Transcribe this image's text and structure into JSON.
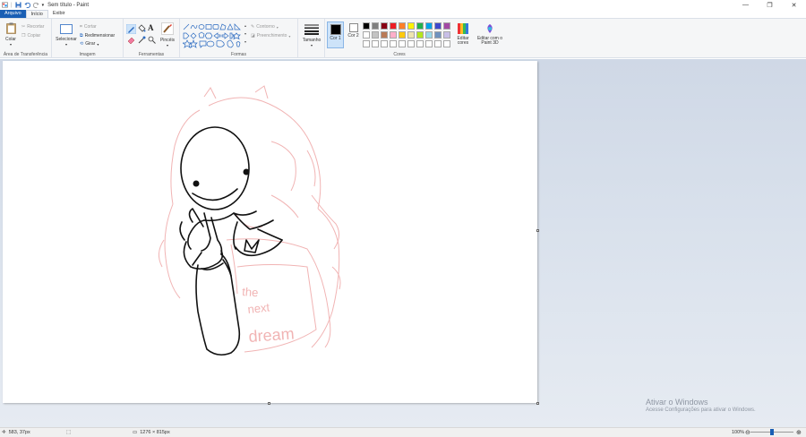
{
  "window": {
    "title": "Sem título - Paint",
    "controls": {
      "minimize": "—",
      "restore": "❐",
      "close": "✕"
    }
  },
  "tabs": [
    {
      "label": "Arquivo"
    },
    {
      "label": "Início"
    },
    {
      "label": "Exibir"
    }
  ],
  "ribbon": {
    "clipboard": {
      "paste": "Colar",
      "cut": "Recortar",
      "copy": "Copiar",
      "label": "Área de Transferência"
    },
    "image": {
      "select": "Selecionar",
      "crop": "Cortar",
      "resize": "Redimensionar",
      "rotate": "Girar",
      "label": "Imagem"
    },
    "tools": {
      "brush": "Pincéis",
      "label": "Ferramentas",
      "text_glyph": "A"
    },
    "shapes": {
      "outline": "Contorno",
      "fill": "Preenchimento",
      "label": "Formas"
    },
    "size": {
      "label": "Tamanho"
    },
    "colors": {
      "color1": "Cor 1",
      "color2": "Cor 2",
      "edit_colors": "Editar cores",
      "paint3d": "Editar com o Paint 3D",
      "label": "Cores",
      "palette": [
        "#000000",
        "#7f7f7f",
        "#880015",
        "#ed1c24",
        "#ff7f27",
        "#fff200",
        "#22b14c",
        "#00a2e8",
        "#3f48cc",
        "#a349a4",
        "#ffffff",
        "#c3c3c3",
        "#b97a57",
        "#ffaec9",
        "#ffc90e",
        "#efe4b0",
        "#b5e61d",
        "#99d9ea",
        "#7092be",
        "#c8bfe7",
        "#ffffff",
        "#ffffff",
        "#ffffff",
        "#ffffff",
        "#ffffff",
        "#ffffff",
        "#ffffff",
        "#ffffff",
        "#ffffff",
        "#ffffff"
      ]
    }
  },
  "canvas": {
    "sketch_text": [
      "the",
      "next",
      "dream"
    ]
  },
  "watermark": {
    "line1": "Ativar o Windows",
    "line2": "Acesse Configurações para ativar o Windows."
  },
  "status": {
    "cursor": "583, 37px",
    "size": "1276 × 815px",
    "zoom": "100%",
    "zoom_level": 0.5
  },
  "colors": {
    "accent": "#1a5fb4",
    "sketch": "#f1b4b4",
    "ink": "#111111"
  }
}
